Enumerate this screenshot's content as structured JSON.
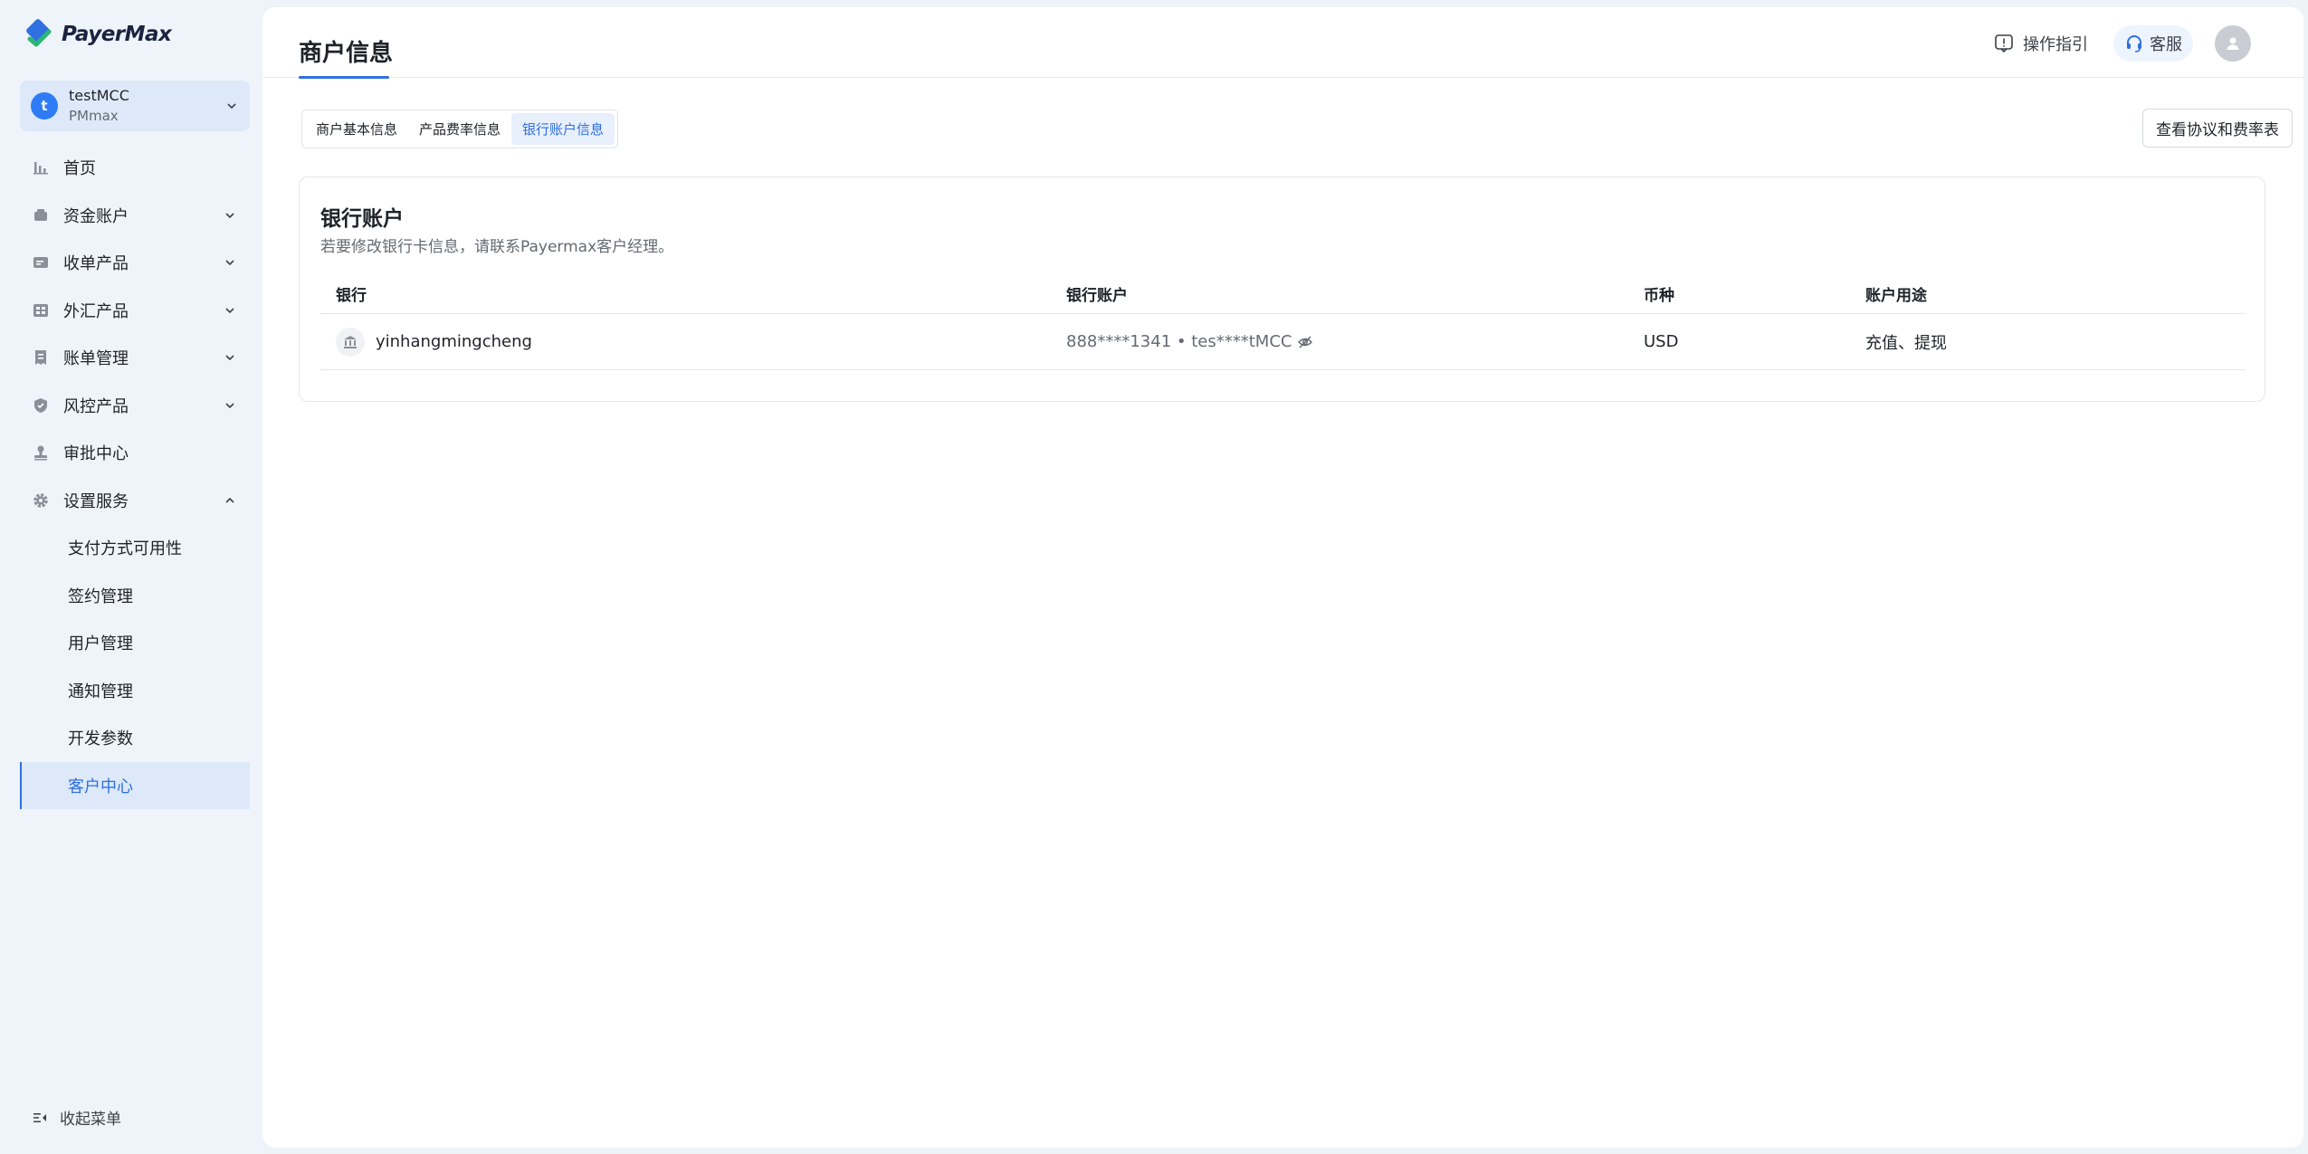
{
  "brand": {
    "name": "PayerMax",
    "colors": {
      "primary": "#2f6fe0",
      "green": "#2bb673"
    }
  },
  "account": {
    "initial": "t",
    "name": "testMCC",
    "sub": "PMmax"
  },
  "sidebar": {
    "items": [
      {
        "label": "首页",
        "icon": "bar-chart-icon"
      },
      {
        "label": "资金账户",
        "icon": "wallet-icon"
      },
      {
        "label": "收单产品",
        "icon": "card-icon"
      },
      {
        "label": "外汇产品",
        "icon": "exchange-icon"
      },
      {
        "label": "账单管理",
        "icon": "bill-icon"
      },
      {
        "label": "风控产品",
        "icon": "shield-icon"
      },
      {
        "label": "审批中心",
        "icon": "stamp-icon"
      },
      {
        "label": "设置服务",
        "icon": "gear-icon"
      }
    ],
    "sub_items": [
      "支付方式可用性",
      "签约管理",
      "用户管理",
      "通知管理",
      "开发参数",
      "客户中心"
    ],
    "active_sub": "客户中心",
    "collapse_label": "收起菜单"
  },
  "header": {
    "title": "商户信息",
    "guide_label": "操作指引",
    "service_label": "客服"
  },
  "tabs": [
    "商户基本信息",
    "产品费率信息",
    "银行账户信息"
  ],
  "active_tab": "银行账户信息",
  "agreement_button": "查看协议和费率表",
  "card": {
    "title": "银行账户",
    "desc": "若要修改银行卡信息，请联系Payermax客户经理。",
    "columns": [
      "银行",
      "银行账户",
      "币种",
      "账户用途"
    ],
    "rows": [
      {
        "bank": "yinhangmingcheng",
        "account": "888****1341 • tes****tMCC",
        "currency": "USD",
        "usage": "充值、提现"
      }
    ]
  }
}
